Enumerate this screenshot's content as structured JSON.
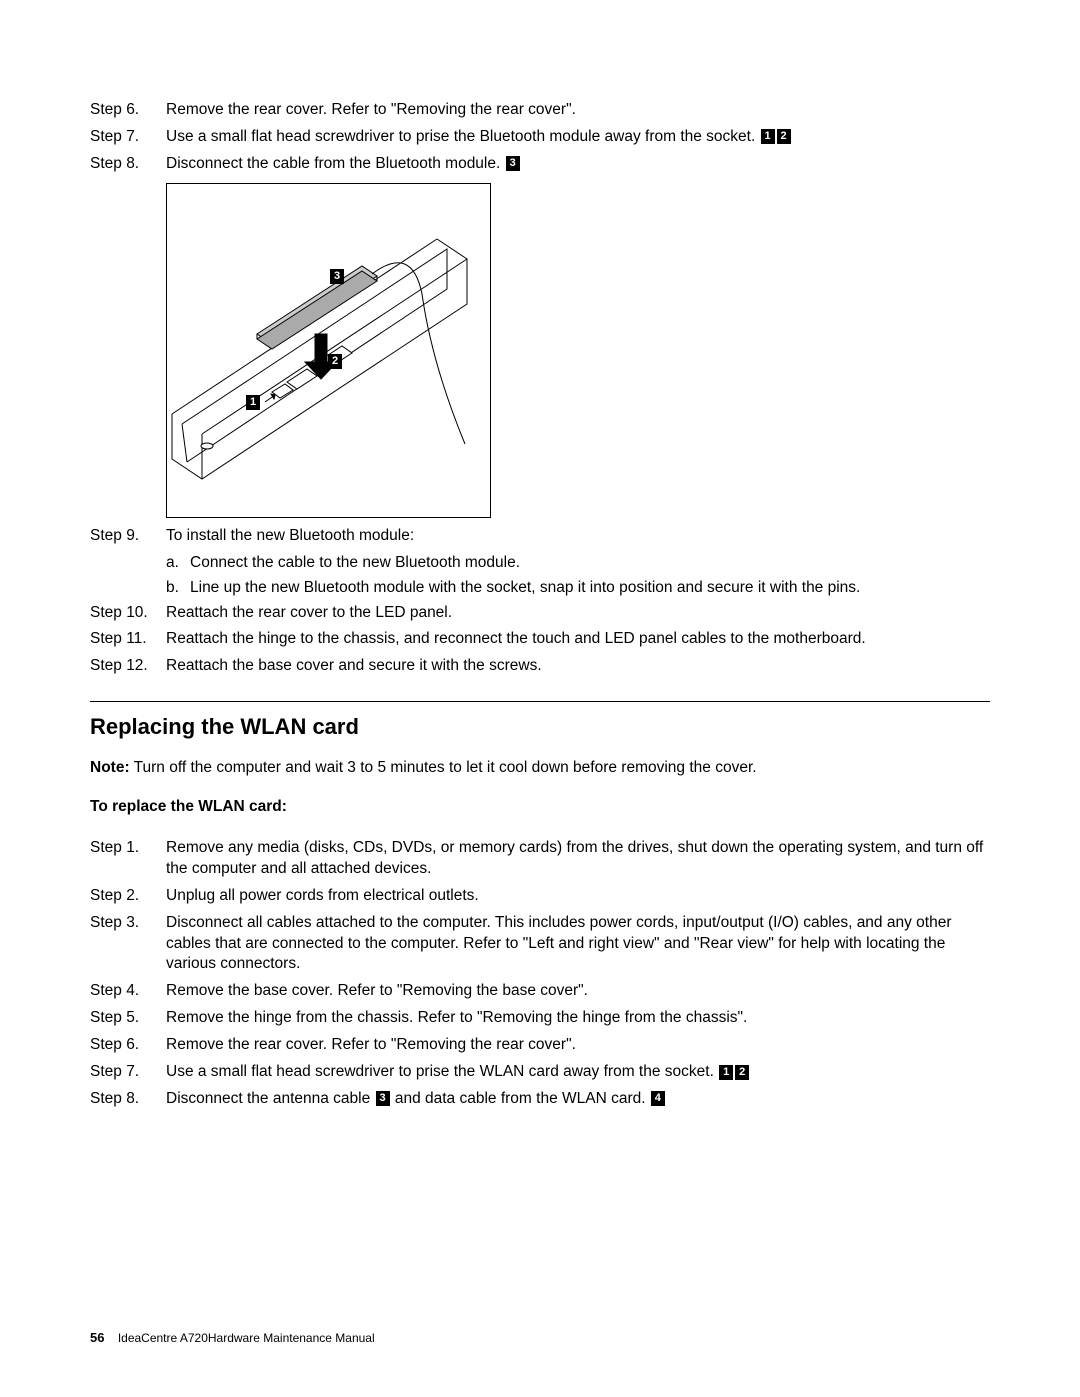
{
  "steps_top": [
    {
      "label": "Step 6.",
      "text": "Remove the rear cover. Refer to \"Removing the rear cover\".",
      "callouts": []
    },
    {
      "label": "Step 7.",
      "text": "Use a small flat head screwdriver to prise the Bluetooth module away from the socket.",
      "callouts": [
        "1",
        "2"
      ]
    },
    {
      "label": "Step 8.",
      "text": "Disconnect the cable from the Bluetooth module.",
      "callouts": [
        "3"
      ]
    }
  ],
  "step9": {
    "label": "Step 9.",
    "text": "To install the new Bluetooth module:"
  },
  "step9_subs": [
    {
      "label": "a.",
      "text": "Connect the cable to the new Bluetooth module."
    },
    {
      "label": "b.",
      "text": "Line up the new Bluetooth module with the socket, snap it into position and secure it with the pins."
    }
  ],
  "steps_after": [
    {
      "label": "Step 10.",
      "text": "Reattach the rear cover to the LED panel."
    },
    {
      "label": "Step 11.",
      "text": "Reattach the hinge to the chassis, and reconnect the touch and LED panel cables to the motherboard."
    },
    {
      "label": "Step 12.",
      "text": "Reattach the base cover and secure it with the screws."
    }
  ],
  "section_heading": "Replacing the WLAN card",
  "note_label": "Note:",
  "note_text": " Turn off the computer and wait 3 to 5 minutes to let it cool down before removing the cover.",
  "sub_heading": "To replace the WLAN card:",
  "wlan_steps": [
    {
      "label": "Step 1.",
      "text": "Remove any media (disks, CDs, DVDs, or memory cards) from the drives, shut down the operating system, and turn off the computer and all attached devices.",
      "callouts": []
    },
    {
      "label": "Step 2.",
      "text": "Unplug all power cords from electrical outlets.",
      "callouts": []
    },
    {
      "label": "Step 3.",
      "text": "Disconnect all cables attached to the computer. This includes power cords, input/output (I/O) cables, and any other cables that are connected to the computer. Refer to \"Left and right view\" and \"Rear view\" for help with locating the various connectors.",
      "callouts": []
    },
    {
      "label": "Step 4.",
      "text": "Remove the base cover. Refer to \"Removing the base cover\".",
      "callouts": []
    },
    {
      "label": "Step 5.",
      "text": "Remove the hinge from the chassis. Refer to \"Removing the hinge from the chassis\".",
      "callouts": []
    },
    {
      "label": "Step 6.",
      "text": "Remove the rear cover. Refer to \"Removing the rear cover\".",
      "callouts": []
    },
    {
      "label": "Step 7.",
      "text": "Use a small flat head screwdriver to prise the WLAN card away from the socket.",
      "callouts": [
        "1",
        "2"
      ]
    }
  ],
  "wlan_step8": {
    "label": "Step 8.",
    "pre": "Disconnect the antenna cable ",
    "mid_callout": "3",
    "mid": " and data cable from the WLAN card. ",
    "end_callout": "4"
  },
  "diagram_callouts": {
    "c1": "1",
    "c2": "2",
    "c3": "3"
  },
  "footer": {
    "page": "56",
    "title": "IdeaCentre A720Hardware Maintenance Manual"
  }
}
